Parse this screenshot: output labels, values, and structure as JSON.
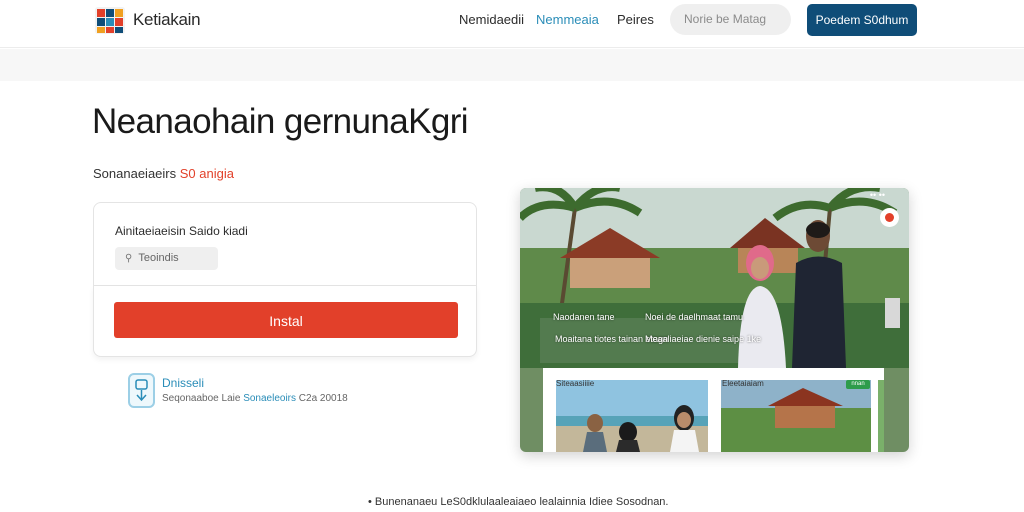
{
  "header": {
    "brand": "Ketiakain",
    "nav": [
      "Nemidaedii",
      "Nemmeaia",
      "Peires"
    ],
    "search_placeholder": "Norie be Matag",
    "cta_label": "Poedem S0dhum",
    "logo_icon": "grid-logo-icon"
  },
  "hero": {
    "title": "Neanaohain gernunaKgri",
    "subtitle_prefix": "Sonanaeiaeirs",
    "subtitle_accent": "S0 anigia"
  },
  "form": {
    "label": "Ainitaeiaeisin Saido kiadi",
    "input_value": "Teoindis",
    "install_label": "Instal"
  },
  "download": {
    "icon": "download-file-icon",
    "title": "Dnisseli",
    "meta_prefix": "Seqonaaboe Laie",
    "meta_link": "Sonaeleoirs",
    "meta_suffix": "C2a 20018"
  },
  "preview": {
    "caption_1": "Naodanen tane",
    "caption_2": "Noei de daelhmaat tamu",
    "caption_3": "Moaitana tiotes tainan etagn",
    "caption_4": "Meaaliaeiae dienie saipe 1ke",
    "dots": "•• ••",
    "thumb_1": "Siteaasiiiie",
    "thumb_2": "Eleetaiaiam",
    "badge": "nnan"
  },
  "footer": {
    "text": "• Bunenanaeu LeS0dklulaaleaiaeo lealainnia Idiee Sosodnan."
  },
  "colors": {
    "accent_red": "#e2402a",
    "primary_blue": "#0f4d78",
    "link_blue": "#2a8db8"
  }
}
